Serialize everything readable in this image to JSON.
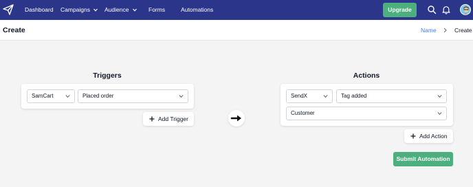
{
  "nav": {
    "items": [
      {
        "label": "Dashboard",
        "has_dropdown": false
      },
      {
        "label": "Campaigns",
        "has_dropdown": true
      },
      {
        "label": "Audience",
        "has_dropdown": true
      },
      {
        "label": "Forms",
        "has_dropdown": false
      },
      {
        "label": "Automations",
        "has_dropdown": false
      }
    ],
    "upgrade_label": "Upgrade",
    "icons": [
      "paper-plane-logo-icon",
      "search-icon",
      "bell-icon",
      "avatar"
    ]
  },
  "header": {
    "title": "Create",
    "breadcrumb": {
      "link": "Name",
      "current": "Create"
    }
  },
  "triggers": {
    "title": "Triggers",
    "app_select": "SamCart",
    "event_select": "Placed order",
    "add_label": "Add Trigger"
  },
  "actions": {
    "title": "Actions",
    "app_select": "SendX",
    "event_select": "Tag added",
    "target_select": "Customer",
    "add_label": "Add Action"
  },
  "submit_label": "Submit Automation",
  "colors": {
    "navbar": "#2b3589",
    "accent_green": "#4caf7d",
    "link_blue": "#3b82f6",
    "page_bg": "#f4f4f5"
  }
}
